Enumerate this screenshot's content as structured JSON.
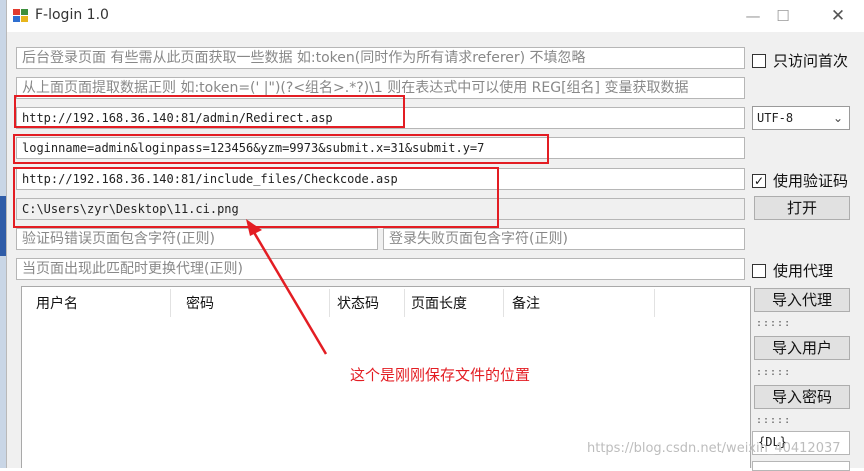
{
  "window": {
    "title": "F-login 1.0"
  },
  "fields": {
    "backend_page": "后台登录页面 有些需从此页面获取一些数据 如:token(同时作为所有请求referer) 不填忽略",
    "regex": "从上面页面提取数据正则 如:token=(' |\")(?<组名>.*?)\\1 则在表达式中可以使用 REG[组名] 变量获取数据",
    "login_url": "http://192.168.36.140:81/admin/Redirect.asp",
    "post_data": "loginname=admin&loginpass=123456&yzm=9973&submit.x=31&submit.y=7",
    "captcha_url": "http://192.168.36.140:81/include_files/Checkcode.asp",
    "captcha_path": "C:\\Users\\zyr\\Desktop\\11.ci.png",
    "captcha_error": "验证码错误页面包含字符(正则)",
    "login_fail": "登录失败页面包含字符(正则)",
    "proxy_switch": "当页面出现此匹配时更换代理(正则)"
  },
  "right_panel": {
    "only_first_label": "只访问首次",
    "encoding_value": "UTF-8",
    "use_captcha_label": "使用验证码",
    "open_button": "打开",
    "use_proxy_label": "使用代理",
    "import_proxy_button": "导入代理",
    "import_user_button": "导入用户",
    "import_password_button": "导入密码",
    "dots": ":::::",
    "dl_value": "{DL}"
  },
  "table": {
    "columns": [
      "用户名",
      "密码",
      "状态码",
      "页面长度",
      "备注"
    ]
  },
  "annotation": {
    "text": "这个是刚刚保存文件的位置"
  },
  "watermark": "https://blog.csdn.net/weixin_40412037",
  "colors": {
    "highlight": "#e31d23",
    "window_bg": "#f0f0f0"
  }
}
